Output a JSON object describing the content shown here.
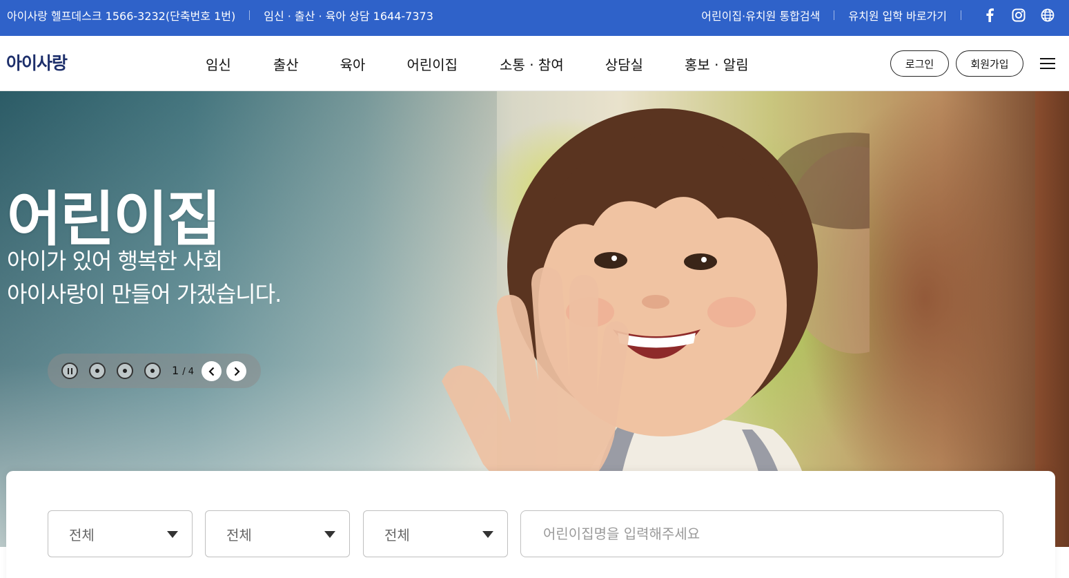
{
  "topbar": {
    "helpdesk": "아이사랑 헬프데스크 1566-3232(단축번호 1번)",
    "consult": "임신 · 출산 · 육아 상담 1644-7373",
    "integrated_search": "어린이집·유치원 통합검색",
    "kindergarten_link": "유치원 입학 바로가기",
    "icons": [
      "facebook-icon",
      "instagram-icon",
      "globe-icon"
    ]
  },
  "header": {
    "logo": "아이사랑",
    "nav": [
      "임신",
      "출산",
      "육아",
      "어린이집",
      "소통 · 참여",
      "상담실",
      "홍보 · 알림"
    ],
    "login_label": "로그인",
    "join_label": "회원가입"
  },
  "hero": {
    "title": "어린이집",
    "subtitle_line1": "아이가 있어 행복한 사회",
    "subtitle_line2": "아이사랑이 만들어 가겠습니다.",
    "slider": {
      "current": "1",
      "total": "4"
    }
  },
  "search": {
    "select1": "전체",
    "select2": "전체",
    "select3": "전체",
    "name_placeholder": "어린이집명을 입력해주세요"
  },
  "colors": {
    "topbar_bg": "#2f62c9",
    "logo": "#1d2f6b"
  }
}
